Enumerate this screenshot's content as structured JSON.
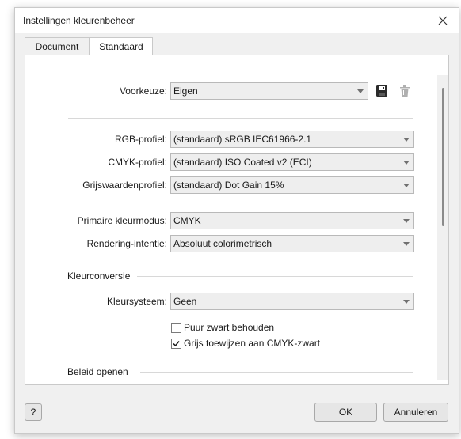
{
  "window": {
    "title": "Instellingen kleurenbeheer",
    "close_icon": "close-icon"
  },
  "tabs": [
    {
      "label": "Document",
      "active": false
    },
    {
      "label": "Standaard",
      "active": true
    }
  ],
  "preset": {
    "label": "Voorkeuze:",
    "value": "Eigen",
    "save_icon": "save-icon",
    "delete_icon": "trash-icon"
  },
  "profiles": {
    "rgb_label": "RGB-profiel:",
    "rgb_value": "(standaard) sRGB IEC61966-2.1",
    "cmyk_label": "CMYK-profiel:",
    "cmyk_value": "(standaard) ISO Coated v2 (ECI)",
    "gray_label": "Grijswaardenprofiel:",
    "gray_value": "(standaard) Dot Gain 15%"
  },
  "mode": {
    "primary_label": "Primaire kleurmodus:",
    "primary_value": "CMYK",
    "intent_label": "Rendering-intentie:",
    "intent_value": "Absoluut colorimetrisch"
  },
  "conversion": {
    "section": "Kleurconversie",
    "system_label": "Kleursysteem:",
    "system_value": "Geen",
    "keep_black_label": "Puur zwart behouden",
    "keep_black_checked": false,
    "gray_to_cmyk_label": "Grijs toewijzen aan CMYK-zwart",
    "gray_to_cmyk_checked": true
  },
  "open_policy": {
    "section": "Beleid openen"
  },
  "footer": {
    "help_label": "?",
    "ok_label": "OK",
    "cancel_label": "Annuleren"
  }
}
